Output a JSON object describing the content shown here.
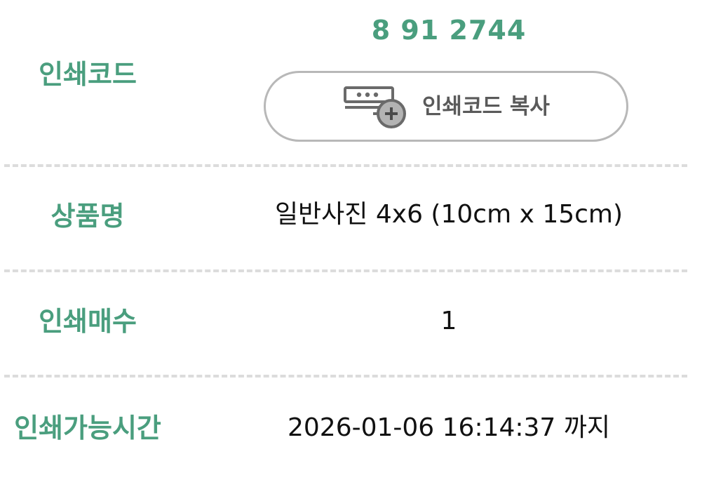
{
  "code": {
    "label": "인쇄코드",
    "number": "8 91 2744",
    "copy_button_label": "인쇄코드 복사",
    "copy_icon": "code-add-icon"
  },
  "product": {
    "label": "상품명",
    "value": "일반사진 4x6 (10cm x 15cm)"
  },
  "count": {
    "label": "인쇄매수",
    "value": "1"
  },
  "available_time": {
    "label": "인쇄가능시간",
    "value": "2026-01-06 16:14:37 까지"
  },
  "colors": {
    "accent": "#4a9e7e",
    "button_border": "#b8b8b8",
    "divider": "#dcdcdc",
    "text": "#111111"
  }
}
